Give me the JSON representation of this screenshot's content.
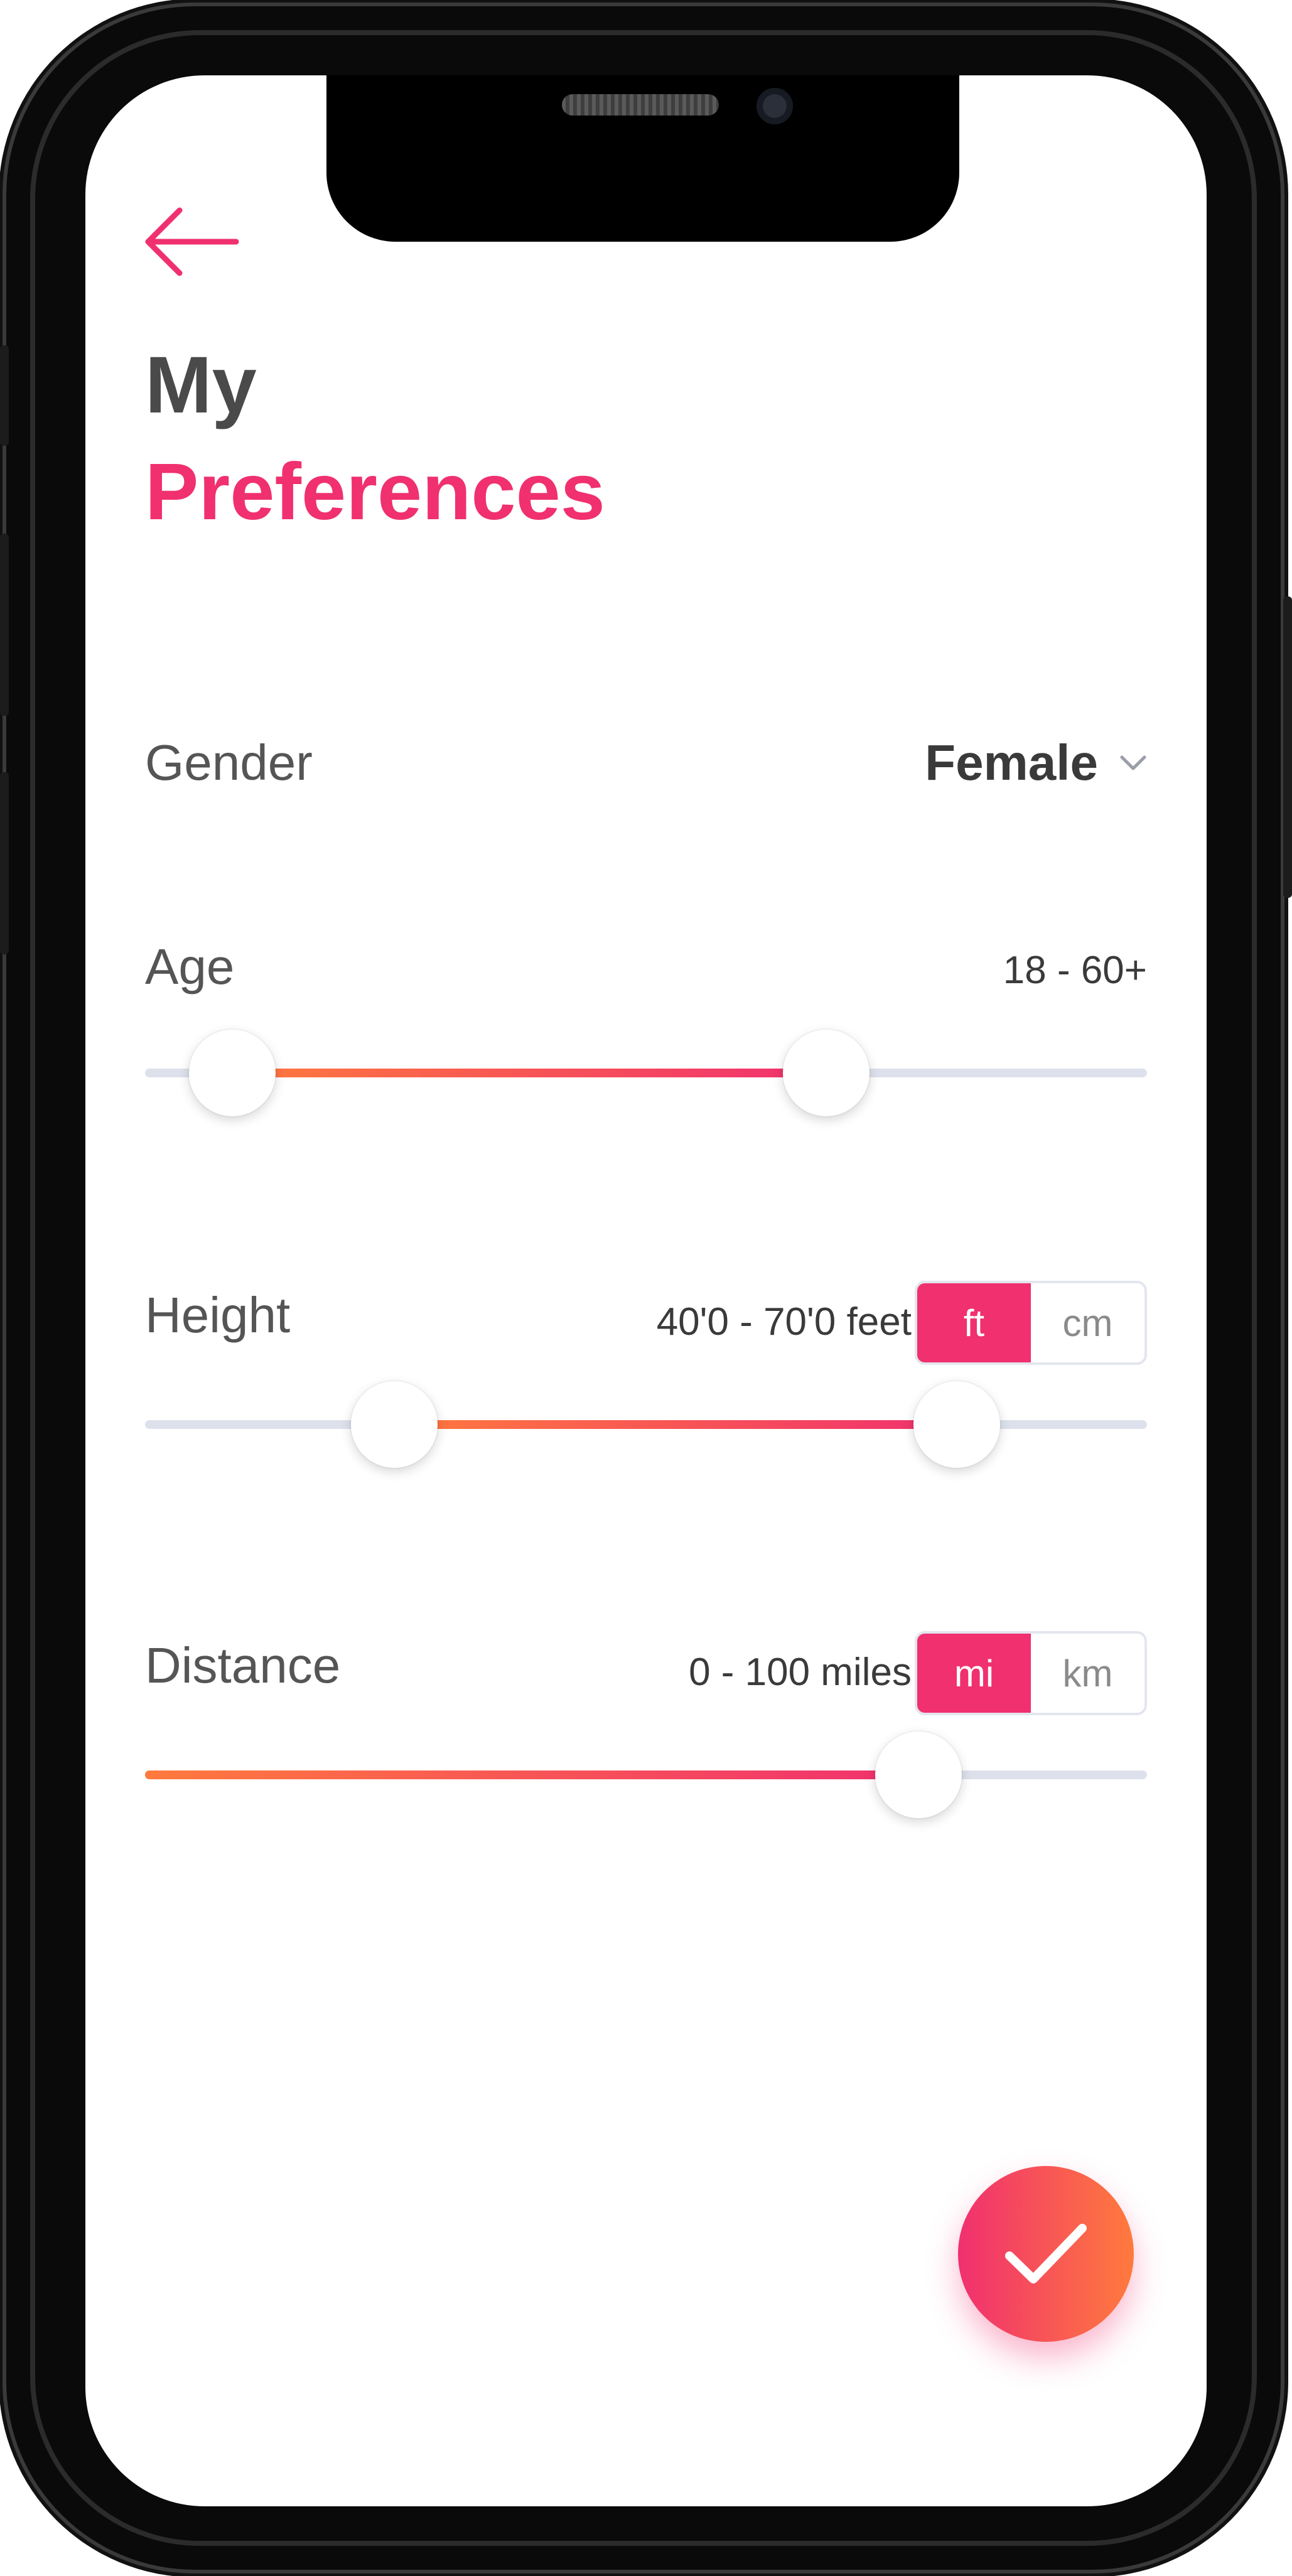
{
  "header": {
    "title_line1": "My",
    "title_line2": "Preferences"
  },
  "colors": {
    "accent": "#f0306f",
    "gradient_start": "#ff7a3d",
    "gradient_end": "#f0306f",
    "track": "#dde1ec"
  },
  "icons": {
    "back": "arrow-left-icon",
    "dropdown": "chevron-down-icon",
    "confirm": "check-icon"
  },
  "gender": {
    "label": "Gender",
    "value": "Female"
  },
  "age": {
    "label": "Age",
    "range_text": "18 - 60+",
    "low_fraction": 0.087,
    "high_fraction": 0.68
  },
  "height": {
    "label": "Height",
    "range_text": "40'0 - 70'0 feet",
    "low_fraction": 0.249,
    "high_fraction": 0.81,
    "units": [
      "ft",
      "cm"
    ],
    "selected_unit": "ft"
  },
  "distance": {
    "label": "Distance",
    "range_text": "0 - 100 miles",
    "value_fraction": 0.772,
    "units": [
      "mi",
      "km"
    ],
    "selected_unit": "mi"
  }
}
